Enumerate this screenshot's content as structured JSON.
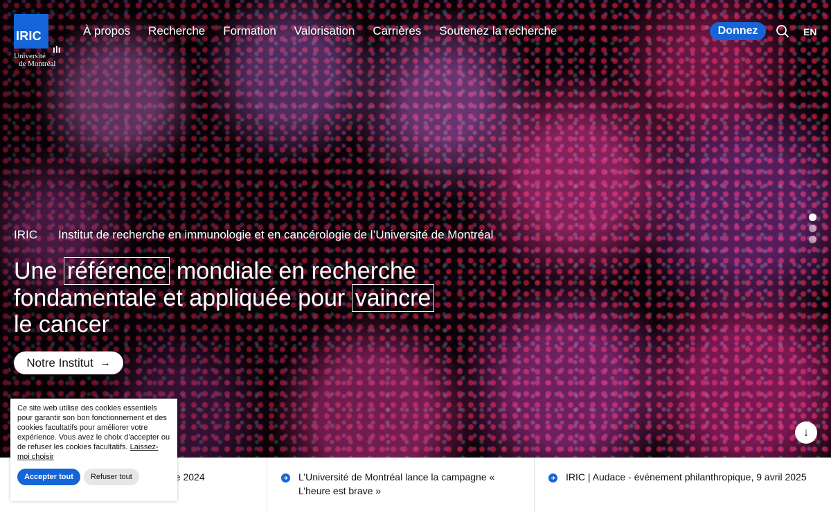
{
  "header": {
    "logo_text": "IRIC",
    "logo_sub_line1": "Université",
    "logo_sub_line2": "de Montréal",
    "nav": [
      {
        "label": "À propos"
      },
      {
        "label": "Recherche"
      },
      {
        "label": "Formation"
      },
      {
        "label": "Valorisation"
      },
      {
        "label": "Carrières"
      },
      {
        "label": "Soutenez la recherche"
      }
    ],
    "donate_label": "Donnez",
    "lang_label": "EN",
    "brand_color": "#1565d8"
  },
  "hero": {
    "kicker_short": "IRIC",
    "kicker_long": "Institut de recherche en immunologie et en cancérologie de l’Université de Montréal",
    "headline": {
      "part1": "Une",
      "highlight1": "référence",
      "part2": "mondiale en recherche fondamentale et appliquée pour",
      "highlight2": "vaincre",
      "part3": "le cancer"
    },
    "cta_label": "Notre Institut",
    "cta_arrow": "→",
    "slides_count": 3,
    "active_slide": 1,
    "scroll_arrow": "↓"
  },
  "news": [
    {
      "text": "ne 2024"
    },
    {
      "text": "L’Université de Montréal lance la campagne « L’heure est brave »"
    },
    {
      "text": "IRIC | Audace - événement philanthropique, 9 avril 2025"
    }
  ],
  "cookie": {
    "text": "Ce site web utilise des cookies essentiels pour garantir son bon fonctionnement et des cookies facultatifs pour améliorer votre expérience. Vous avez le choix d’accepter ou de refuser les cookies facultatifs.",
    "link": "Laissez-moi choisir",
    "accept_label": "Accepter tout",
    "refuse_label": "Refuser tout"
  }
}
